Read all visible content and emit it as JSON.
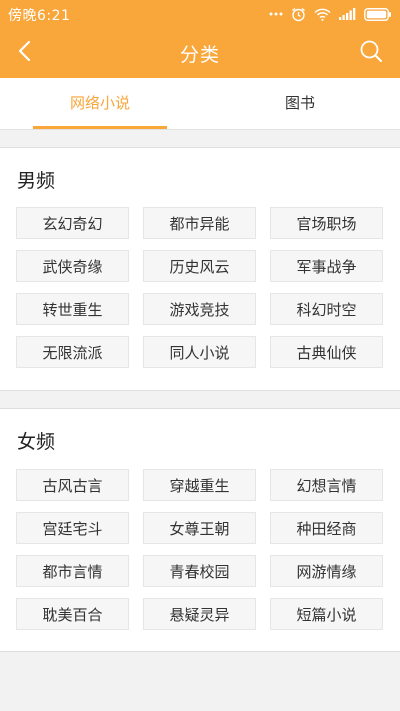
{
  "status": {
    "time": "傍晚6:21",
    "icons": [
      "more-dots-icon",
      "alarm-icon",
      "wifi-icon",
      "signal-icon",
      "battery-icon"
    ]
  },
  "header": {
    "title": "分类",
    "back_icon": "back-arrow-icon",
    "search_icon": "search-icon",
    "color": "#f9a63a"
  },
  "tabs": [
    {
      "label": "网络小说",
      "active": true
    },
    {
      "label": "图书",
      "active": false
    }
  ],
  "sections": [
    {
      "title": "男频",
      "categories": [
        "玄幻奇幻",
        "都市异能",
        "官场职场",
        "武侠奇缘",
        "历史风云",
        "军事战争",
        "转世重生",
        "游戏竞技",
        "科幻时空",
        "无限流派",
        "同人小说",
        "古典仙侠"
      ]
    },
    {
      "title": "女频",
      "categories": [
        "古风古言",
        "穿越重生",
        "幻想言情",
        "宫廷宅斗",
        "女尊王朝",
        "种田经商",
        "都市言情",
        "青春校园",
        "网游情缘",
        "耽美百合",
        "悬疑灵异",
        "短篇小说"
      ]
    }
  ]
}
